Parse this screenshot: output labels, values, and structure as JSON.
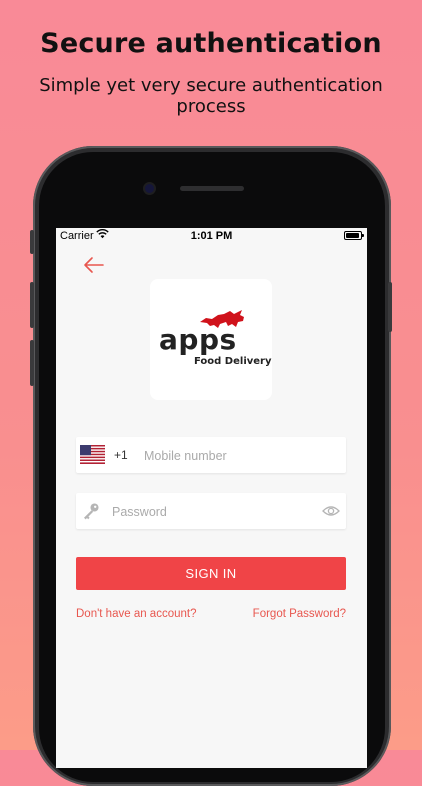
{
  "promo": {
    "title": "Secure authentication",
    "subtitle": "Simple yet very secure authentication process"
  },
  "status_bar": {
    "carrier": "Carrier",
    "time": "1:01 PM"
  },
  "header": {
    "back_icon": "arrow-left-icon"
  },
  "logo": {
    "wordmark": "apps",
    "tagline": "Food Delivery",
    "emblem": "rhino-icon"
  },
  "form": {
    "country_flag": "us-flag-icon",
    "dial_code": "+1",
    "mobile_placeholder": "Mobile number",
    "password_placeholder": "Password",
    "password_icon": "key-icon",
    "visibility_icon": "eye-icon",
    "signin_label": "SIGN IN",
    "signup_link": "Don't have an account?",
    "forgot_link": "Forgot Password?"
  },
  "colors": {
    "accent": "#f04447",
    "link": "#e8574f",
    "background_top": "#f98a97",
    "background_bottom": "#fc9c88"
  }
}
